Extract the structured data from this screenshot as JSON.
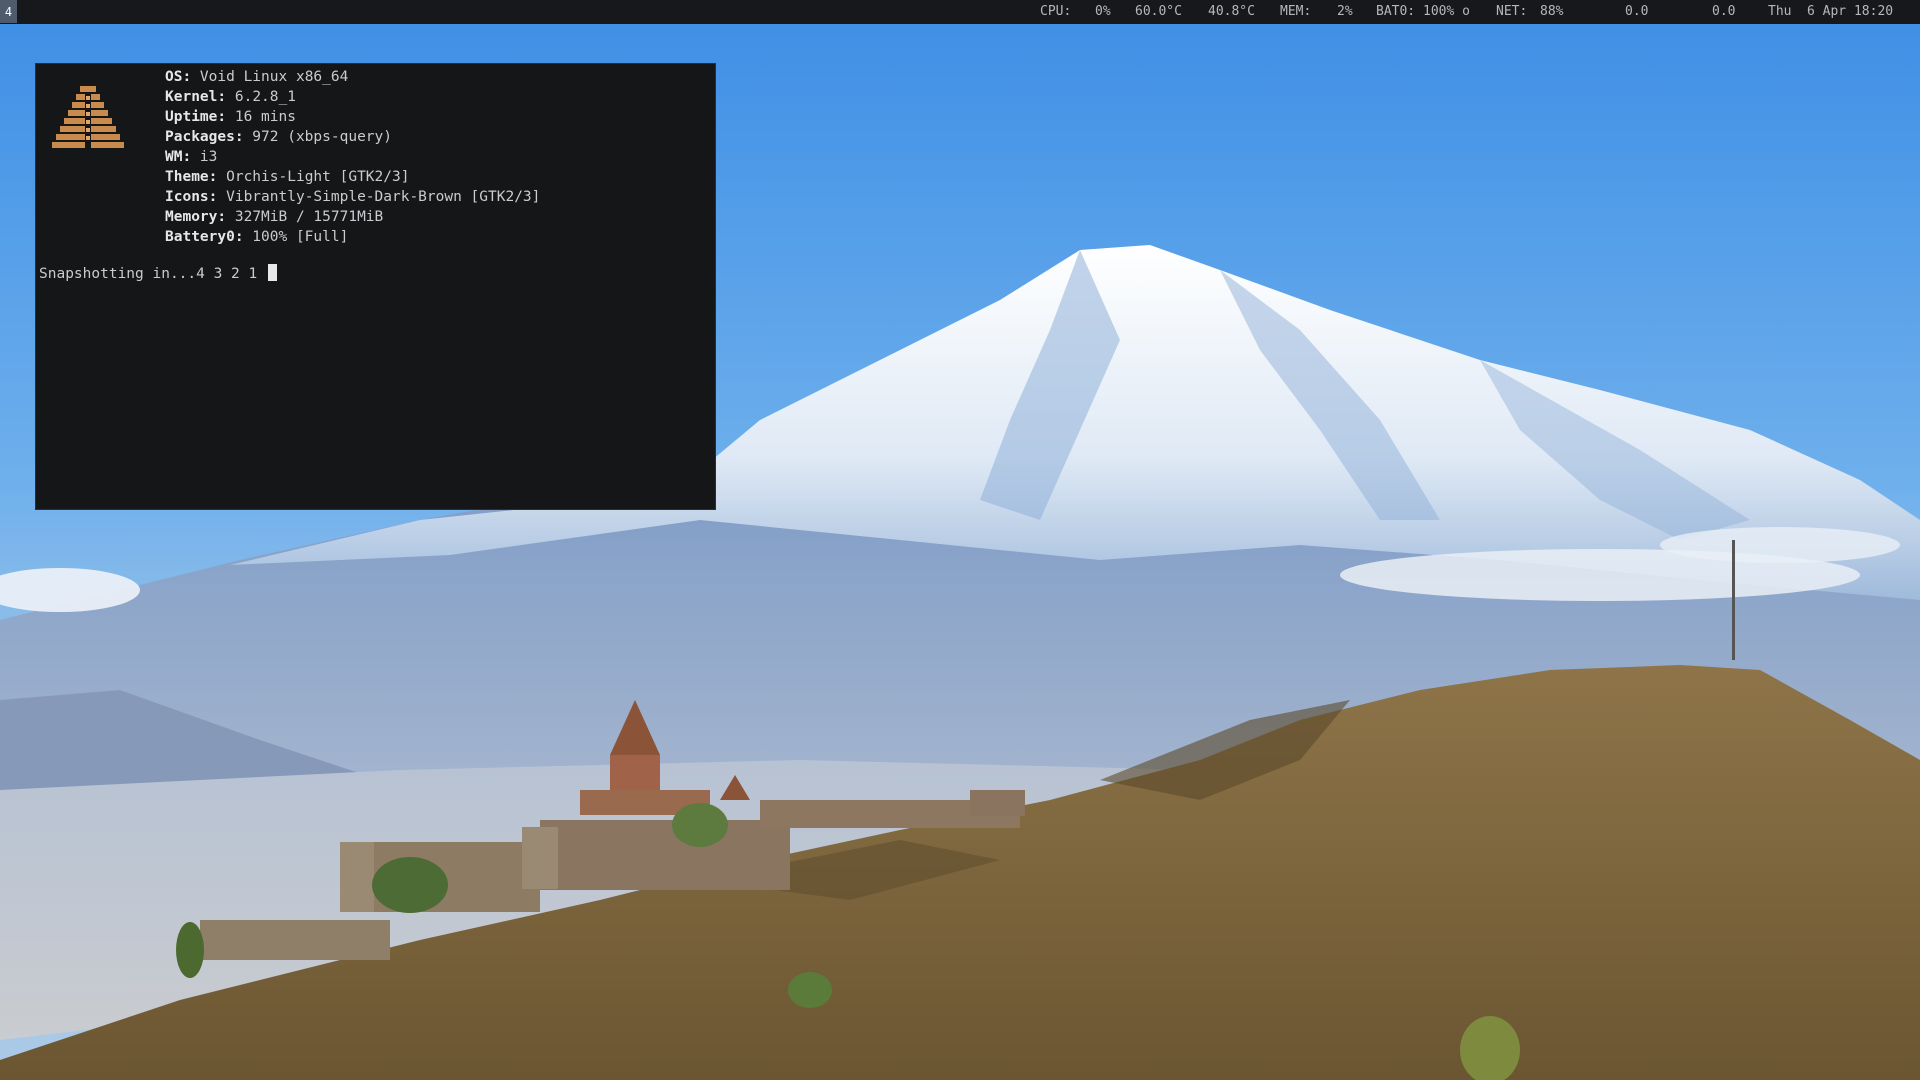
{
  "topbar": {
    "workspace": "4",
    "cpu_label": "CPU:",
    "cpu_value": "0%",
    "temp1": "60.0°C",
    "temp2": "40.8°C",
    "mem_label": "MEM:",
    "mem_value": "2%",
    "bat_label": "BAT0:",
    "bat_value": "100% o",
    "net_label": "NET:",
    "net_value": "88%",
    "net_down": "0.0",
    "net_up": "0.0",
    "day": "Thu",
    "datetime": "6 Apr 18:20"
  },
  "terminal": {
    "info": [
      {
        "key": "OS",
        "value": " Void Linux x86_64"
      },
      {
        "key": "Kernel",
        "value": " 6.2.8_1"
      },
      {
        "key": "Uptime",
        "value": " 16 mins"
      },
      {
        "key": "Packages",
        "value": " 972 (xbps-query)"
      },
      {
        "key": "WM",
        "value": " i3"
      },
      {
        "key": "Theme",
        "value": " Orchis-Light [GTK2/3]"
      },
      {
        "key": "Icons",
        "value": " Vibrantly-Simple-Dark-Brown [GTK2/3]"
      },
      {
        "key": "Memory",
        "value": " 327MiB / 15771MiB"
      },
      {
        "key": "Battery0",
        "value": " 100% [Full]"
      }
    ],
    "snapshot_line": "Snapshotting in...4 3 2 1 "
  },
  "colors": {
    "bar_bg": "#16181b",
    "terminal_bg": "#151618",
    "logo": "#c98a4e",
    "workspace_bg": "#4f5a6a"
  },
  "icons": {
    "logo": "pyramid-logo-icon"
  }
}
